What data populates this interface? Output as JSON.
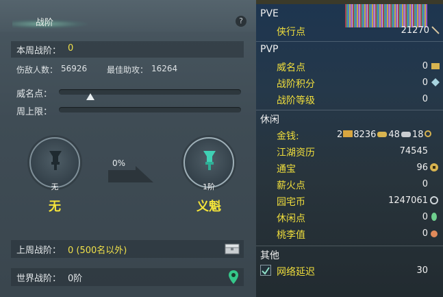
{
  "left": {
    "title": "战阶",
    "help": "?",
    "this_week_label": "本周战阶：",
    "this_week_value": "0",
    "damage_label": "伤敌人数：",
    "damage_value": "56926",
    "assist_label": "最佳助攻：",
    "assist_value": "16264",
    "prestige_label": "威名点：",
    "prestige_progress": 0.12,
    "weekly_cap_label": "周上限：",
    "current_rank_level": "无",
    "current_rank_name": "无",
    "progress_percent": "0%",
    "next_rank_level": "1阶",
    "next_rank_name": "义魁",
    "last_week_label": "上周战阶：",
    "last_week_value": "0 (500名以外)",
    "world_label": "世界战阶：",
    "world_value": "0阶"
  },
  "right": {
    "top_strip": "...",
    "pve_header": "PVE",
    "xiaxing_label": "侠行点",
    "xiaxing_value": "21270",
    "pvp_header": "PVP",
    "weiming_label": "威名点",
    "weiming_value": "0",
    "zhanjie_points_label": "战阶积分",
    "zhanjie_points_value": "0",
    "zhanjie_level_label": "战阶等级",
    "zhanjie_level_value": "0",
    "leisure_header": "休闲",
    "money_label": "金钱:",
    "money_gold": "2",
    "money_silver": "8236",
    "money_copper": "48",
    "money_wen": "18",
    "jianghu_label": "江湖资历",
    "jianghu_value": "74545",
    "tongbao_label": "通宝",
    "tongbao_value": "96",
    "xinhuo_label": "薪火点",
    "xinhuo_value": "0",
    "yuanzhai_label": "园宅币",
    "yuanzhai_value": "1247061",
    "xiuxian_label": "休闲点",
    "xiuxian_value": "0",
    "taoli_label": "桃李值",
    "taoli_value": "0",
    "other_header": "其他",
    "latency_label": "网络延迟",
    "latency_value": "30"
  }
}
